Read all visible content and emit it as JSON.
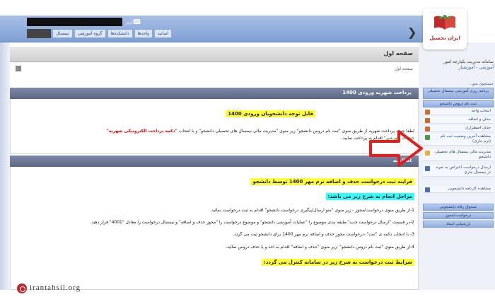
{
  "topbar": {
    "user_label": "نام کاربر",
    "tabs": [
      "اساتید",
      "واحدها",
      "دانشکده‌ها",
      "گروه آموزشی",
      "نیمسال"
    ]
  },
  "main": {
    "page_title": "صفحه اول",
    "breadcrumb": "صفحه اول",
    "section1": {
      "title": "پرداخت شهریه ورودی 1400",
      "highlight": "قابل توجه دانشجویان ورودی 1400",
      "line1_a": "لطفا جهت پرداخت شهریه از طریق منوی \"ثبت نام دروس دانشجو\" زیر منوی \"مدیریت مالی نیمسال های تحصیلی دانشجو\" و با انتخاب",
      "line1_red": "\"دکمه پرداخت الکترونیکی شهریه\"",
      "line2_green": "خدمات آموزشی\"",
      "line2_b": "اقدام به پرداخت نمایید."
    },
    "section2": {
      "title": "اطلاعیه",
      "highlight": "فرایند ثبت درخواست حذف و اضافه ترم مهر 1400 توسط دانشجو",
      "cyan": "مراحل انجام به شرح زیر می باشد:",
      "steps": [
        "1-از طریق منوی درخواست/مجوز - زیر منوی \"منو ارسال/پیگیری درخواست دانشجو\" اقدام به ثبت درخواست نمائید.",
        "2-در قسمت \"ارسال درخواست جدید\"،طبقه بندی موضوع را \"عملیات آموزشی دانشجو\" و موضوع درخواست را \"مجوز حذف و اضافه\" و نیمسال درخواست را معادل \"4001\" قرار دهید.",
        "3- با انتخاب دکمه ی \"ثبت\" -درخواست مجوز حذف و اضافه ترم مهر 1400 برای دانشجو ثبت می گردد.",
        "4-از طریق منوی \"ثبت نام دروس دانشجو\" -زیر منوی \"حذف و اضافه\" اقدام به اخذ و یا حذف دروس نمائید."
      ],
      "highlight2": "شرایط ثبت درخواست به شرح زیر در سامانه کنترل می گردد:"
    }
  },
  "sidebar": {
    "brand": "ایران تحصیل",
    "system_name": "سامانه مدیریت یکپارچه امور",
    "system_sub": "آموزشی - آموزشیار",
    "search_label": "جستجوی منو...",
    "menu": [
      {
        "type": "hdr",
        "label": "برنامه ریزی آموزشی نیمسال تحصیلی"
      },
      {
        "type": "hdr",
        "label": "ثبت نام دروس دانشجو"
      },
      {
        "type": "item",
        "label": "انتخاب واحد",
        "icon": "enroll-icon"
      },
      {
        "type": "item",
        "label": "حذف و اضافه",
        "icon": "add-drop-icon"
      },
      {
        "type": "item",
        "label": "حذف اضطراری",
        "icon": "emergency-drop-icon"
      },
      {
        "type": "item",
        "label": "مشاهده آخرین وضعیت ثبت نام (ترم جاری)",
        "icon": "status-icon"
      },
      {
        "type": "item",
        "label": "مدیریت مالی نیمسال های تحصیلی دانشجو",
        "icon": "finance-icon"
      },
      {
        "type": "item",
        "label": "ارسال درخواست اعتراض به نمره در نیمسال جاری",
        "icon": "objection-icon"
      },
      {
        "type": "item",
        "label": "مشاهده کارنامه دانشجویی",
        "icon": "transcript-icon"
      },
      {
        "type": "hdr",
        "label": "صندوق رفاه دانشجویی"
      },
      {
        "type": "hdr",
        "label": "درخواست/مجوز"
      },
      {
        "type": "hdr",
        "label": "ارزشیابی استاد"
      }
    ]
  },
  "footer": {
    "url": "irantahsil.org"
  }
}
